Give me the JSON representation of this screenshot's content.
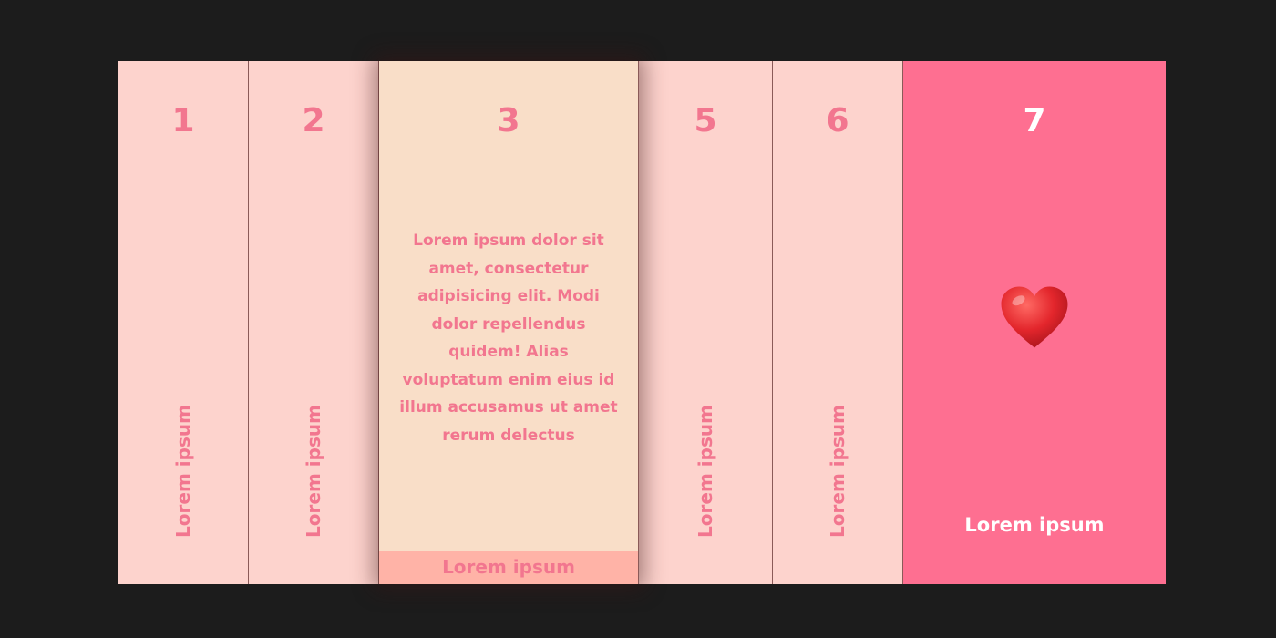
{
  "colors": {
    "background": "#1c1c1c",
    "panel": "#fdd3cd",
    "panel_open": "#f9dec8",
    "panel_open_footer": "#ffb3a7",
    "panel_highlight": "#fe6f91",
    "text_accent": "#f2768f",
    "heart": "#e3262c"
  },
  "cards": [
    {
      "number": "1",
      "label": "Lorem ipsum",
      "state": "collapsed"
    },
    {
      "number": "2",
      "label": "Lorem ipsum",
      "state": "collapsed"
    },
    {
      "number": "3",
      "label": "Lorem ipsum",
      "state": "expanded",
      "body": "Lorem ipsum dolor sit amet, consectetur adipisicing elit. Modi dolor repellendus quidem! Alias voluptatum enim eius id illum accusamus ut amet rerum delectus"
    },
    {
      "number": "5",
      "label": "Lorem ipsum",
      "state": "collapsed"
    },
    {
      "number": "6",
      "label": "Lorem ipsum",
      "state": "collapsed"
    },
    {
      "number": "7",
      "label": "Lorem ipsum",
      "state": "highlighted",
      "icon": "heart-icon"
    }
  ]
}
